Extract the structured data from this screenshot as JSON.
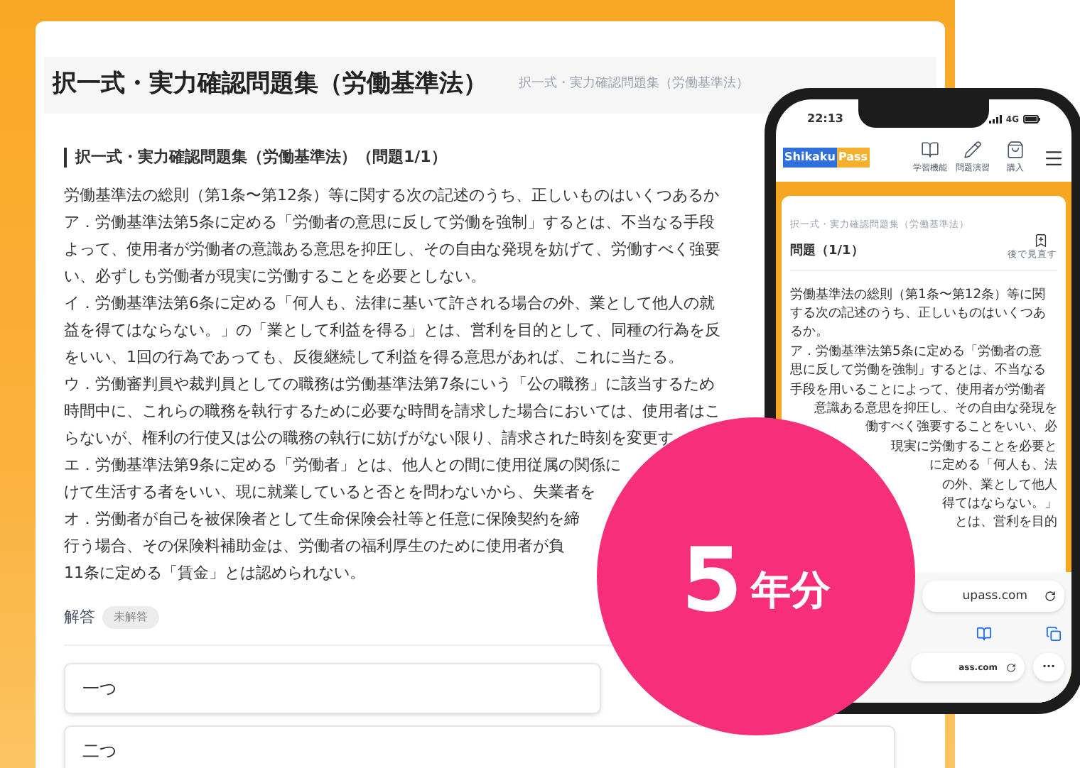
{
  "page_header": {
    "title": "択一式・実力確認問題集（労働基準法）",
    "subtitle": "択一式・実力確認問題集（労働基準法）"
  },
  "question": {
    "heading": "択一式・実力確認問題集（労働基準法）（問題1/1）",
    "lines": [
      "労働基準法の総則（第1条〜第12条）等に関する次の記述のうち、正しいものはいくつあるか",
      "ア．労働基準法第5条に定める「労働者の意思に反して労働を強制」するとは、不当なる手段",
      "よって、使用者が労働者の意識ある意思を抑圧し、その自由な発現を妨げて、労働すべく強要",
      "い、必ずしも労働者が現実に労働することを必要としない。",
      "イ．労働基準法第6条に定める「何人も、法律に基いて許される場合の外、業として他人の就",
      "益を得てはならない。」の「業として利益を得る」とは、営利を目的として、同種の行為を反",
      "をいい、1回の行為であっても、反復継続して利益を得る意思があれば、これに当たる。",
      "ウ．労働審判員や裁判員としての職務は労働基準法第7条にいう「公の職務」に該当するため",
      "時間中に、これらの職務を執行するために必要な時間を請求した場合においては、使用者はこ",
      "らないが、権利の行使又は公の職務の執行に妨げがない限り、請求された時刻を変更す",
      "エ．労働基準法第9条に定める「労働者」とは、他人との間に使用従属の関係に",
      "けて生活する者をいい、現に就業していると否とを問わないから、失業者を",
      "オ．労働者が自己を被保険者として生命保険会社等と任意に保険契約を締",
      "行う場合、その保険料補助金は、労働者の福利厚生のために使用者が負",
      "11条に定める「賃金」とは認められない。"
    ]
  },
  "answer": {
    "label": "解答",
    "status": "未解答",
    "options": [
      "一つ",
      "二つ"
    ]
  },
  "phone": {
    "time": "22:13",
    "network": "4G",
    "logo": [
      "Shikaku",
      "Pass"
    ],
    "nav": [
      {
        "label": "学習機能"
      },
      {
        "label": "問題演習"
      },
      {
        "label": "購入"
      }
    ],
    "breadcrumb": "択一式・実力確認問題集（労働基準法）",
    "question_title": "問題（1/1）",
    "bookmark_label": "後で見直す",
    "lines": [
      {
        "kind": "line",
        "text": "労働基準法の総則（第1条〜第12条）等に関"
      },
      {
        "kind": "line",
        "text": "する次の記述のうち、正しいものはいくつあ"
      },
      {
        "kind": "line",
        "text": "るか。"
      },
      {
        "kind": "line",
        "text": "ア．労働基準法第5条に定める「労働者の意"
      },
      {
        "kind": "line",
        "text": "思に反して労働を強制」するとは、不当なる"
      },
      {
        "kind": "line",
        "text": "手段を用いることによって、使用者が労働者"
      },
      {
        "kind": "tail",
        "text": "意識ある意思を抑圧し、その自由な発現を"
      },
      {
        "kind": "tail",
        "text": "働すべく強要することをいい、必"
      },
      {
        "kind": "tail",
        "text": "現実に労働することを必要と"
      },
      {
        "kind": "tail",
        "text": "に定める「何人も、法"
      },
      {
        "kind": "tail",
        "text": "の外、業として他人"
      },
      {
        "kind": "tail",
        "text": "得てはならない。」"
      },
      {
        "kind": "tail",
        "text": "とは、営利を目的"
      }
    ],
    "address": "upass.com",
    "address_small": "ass.com",
    "more": "···"
  },
  "promo": {
    "number": "5",
    "unit": "年分"
  }
}
